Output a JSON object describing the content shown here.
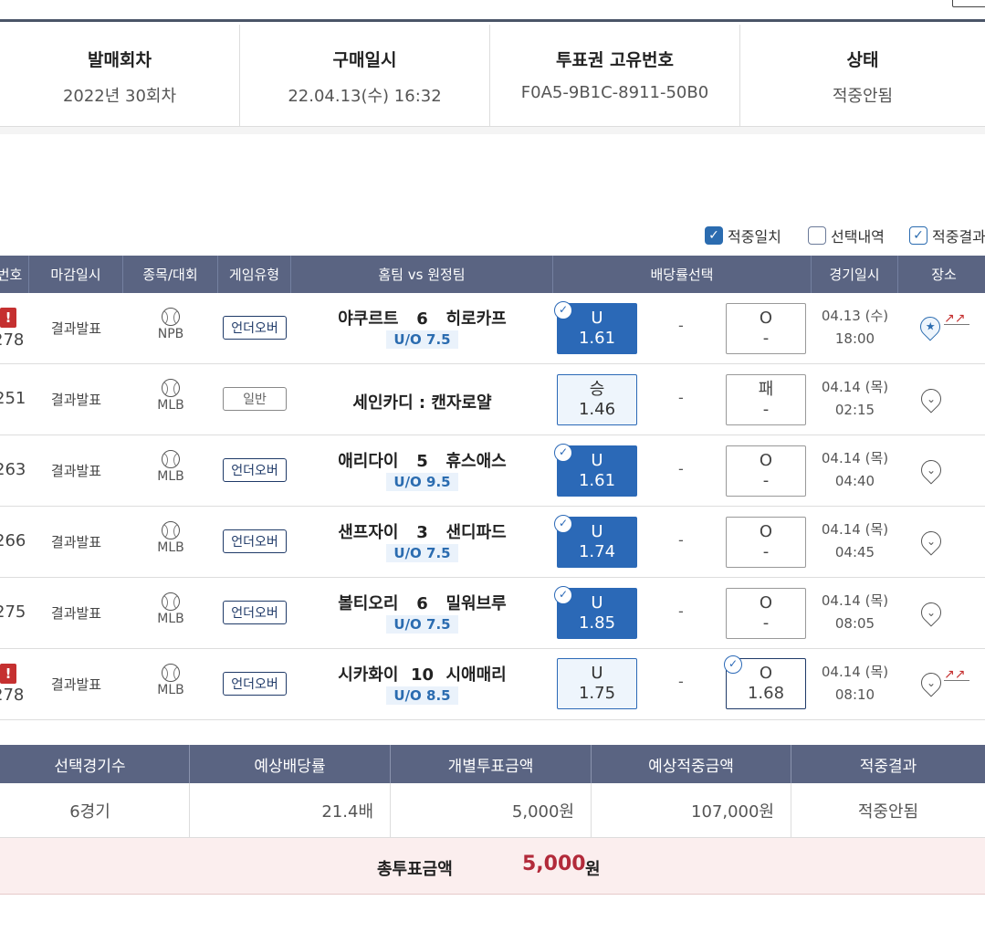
{
  "info": [
    {
      "label": "발매회차",
      "value": "2022년 30회차"
    },
    {
      "label": "구매일시",
      "value": "22.04.13(수) 16:32"
    },
    {
      "label": "투표권 고유번호",
      "value": "F0A5-9B1C-8911-50B0"
    },
    {
      "label": "상태",
      "value": "적중안됨"
    }
  ],
  "filters": [
    {
      "label": "적중일치",
      "state": "checked"
    },
    {
      "label": "선택내역",
      "state": "unchecked"
    },
    {
      "label": "적중결과",
      "state": "outline-checked"
    }
  ],
  "table_headers": {
    "num": "번호",
    "closing": "마감일시",
    "sport": "종목/대회",
    "gametype": "게임유형",
    "teams": "홈팀 vs 원정팀",
    "odds": "배당률선택",
    "gamedate": "경기일시",
    "place": "장소"
  },
  "rows": [
    {
      "num": "278",
      "warn": "!",
      "closing": "결과발표",
      "league": "NPB",
      "gametype": "언더오버",
      "home": "야쿠르트",
      "score": "6",
      "away": "히로카프",
      "line": "U/O 7.5",
      "left_label": "U",
      "left_odd": "1.61",
      "mid": "-",
      "right_label": "O",
      "right_odd": "-",
      "date": "04.13 (수)",
      "time": "18:00"
    },
    {
      "num": "251",
      "warn": "",
      "closing": "결과발표",
      "league": "MLB",
      "gametype": "일반",
      "match": "세인카디 : 캔자로얄",
      "left_label": "승",
      "left_odd": "1.46",
      "mid": "-",
      "right_label": "패",
      "right_odd": "-",
      "date": "04.14 (목)",
      "time": "02:15"
    },
    {
      "num": "263",
      "warn": "",
      "closing": "결과발표",
      "league": "MLB",
      "gametype": "언더오버",
      "home": "애리다이",
      "score": "5",
      "away": "휴스애스",
      "line": "U/O 9.5",
      "left_label": "U",
      "left_odd": "1.61",
      "mid": "-",
      "right_label": "O",
      "right_odd": "-",
      "date": "04.14 (목)",
      "time": "04:40"
    },
    {
      "num": "266",
      "warn": "",
      "closing": "결과발표",
      "league": "MLB",
      "gametype": "언더오버",
      "home": "샌프자이",
      "score": "3",
      "away": "샌디파드",
      "line": "U/O 7.5",
      "left_label": "U",
      "left_odd": "1.74",
      "mid": "-",
      "right_label": "O",
      "right_odd": "-",
      "date": "04.14 (목)",
      "time": "04:45"
    },
    {
      "num": "275",
      "warn": "",
      "closing": "결과발표",
      "league": "MLB",
      "gametype": "언더오버",
      "home": "볼티오리",
      "score": "6",
      "away": "밀워브루",
      "line": "U/O 7.5",
      "left_label": "U",
      "left_odd": "1.85",
      "mid": "-",
      "right_label": "O",
      "right_odd": "-",
      "date": "04.14 (목)",
      "time": "08:05"
    },
    {
      "num": "278",
      "warn": "!",
      "closing": "결과발표",
      "league": "MLB",
      "gametype": "언더오버",
      "home": "시카화이",
      "score": "10",
      "away": "시애매리",
      "line": "U/O 8.5",
      "left_label": "U",
      "left_odd": "1.75",
      "mid": "-",
      "right_label": "O",
      "right_odd": "1.68",
      "date": "04.14 (목)",
      "time": "08:10"
    }
  ],
  "summary_headers": [
    "선택경기수",
    "예상배당률",
    "개별투표금액",
    "예상적중금액",
    "적중결과"
  ],
  "summary_values": [
    "6경기",
    "21.4배",
    "5,000원",
    "107,000원",
    "적중안됨"
  ],
  "total": {
    "label": "총투표금액",
    "value": "5,000",
    "unit": "원"
  },
  "colors": {
    "header_bg": "#5a6482",
    "selected_odd": "#2b69b7",
    "total_amount": "#b22a3a"
  }
}
